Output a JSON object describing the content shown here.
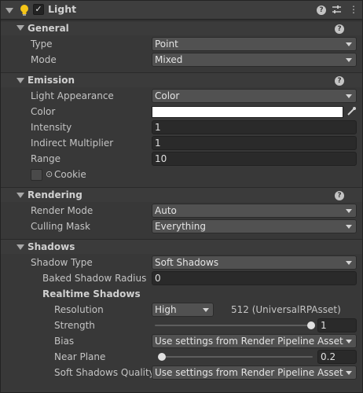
{
  "component": {
    "title": "Light",
    "enabled": true,
    "enabled_mark": "✓",
    "help_glyph": "?",
    "icons": [
      "lightbulb-icon",
      "help-icon",
      "presets-icon",
      "more-menu-icon"
    ],
    "more_glyph": "⋮"
  },
  "general": {
    "title": "General",
    "type_label": "Type",
    "type_value": "Point",
    "mode_label": "Mode",
    "mode_value": "Mixed"
  },
  "emission": {
    "title": "Emission",
    "appearance_label": "Light Appearance",
    "appearance_value": "Color",
    "color_label": "Color",
    "color_value": "#ffffff",
    "intensity_label": "Intensity",
    "intensity_value": "1",
    "indirect_label": "Indirect Multiplier",
    "indirect_value": "1",
    "range_label": "Range",
    "range_value": "10",
    "cookie_label": "Cookie",
    "cookie_glyph": "⊙"
  },
  "rendering": {
    "title": "Rendering",
    "render_mode_label": "Render Mode",
    "render_mode_value": "Auto",
    "culling_label": "Culling Mask",
    "culling_value": "Everything"
  },
  "shadows": {
    "title": "Shadows",
    "shadow_type_label": "Shadow Type",
    "shadow_type_value": "Soft Shadows",
    "baked_radius_label": "Baked Shadow Radius",
    "baked_radius_value": "0",
    "realtime_title": "Realtime Shadows",
    "resolution_label": "Resolution",
    "resolution_value": "High",
    "resolution_note": "512 (UniversalRPAsset)",
    "strength_label": "Strength",
    "strength_value": "1",
    "strength_fraction": 1.0,
    "bias_label": "Bias",
    "bias_value": "Use settings from Render Pipeline Asset",
    "near_plane_label": "Near Plane",
    "near_plane_value": "0.2",
    "near_plane_fraction": 0.0,
    "soft_quality_label": "Soft Shadows Quality",
    "soft_quality_value": "Use settings from Render Pipeline Asset"
  }
}
